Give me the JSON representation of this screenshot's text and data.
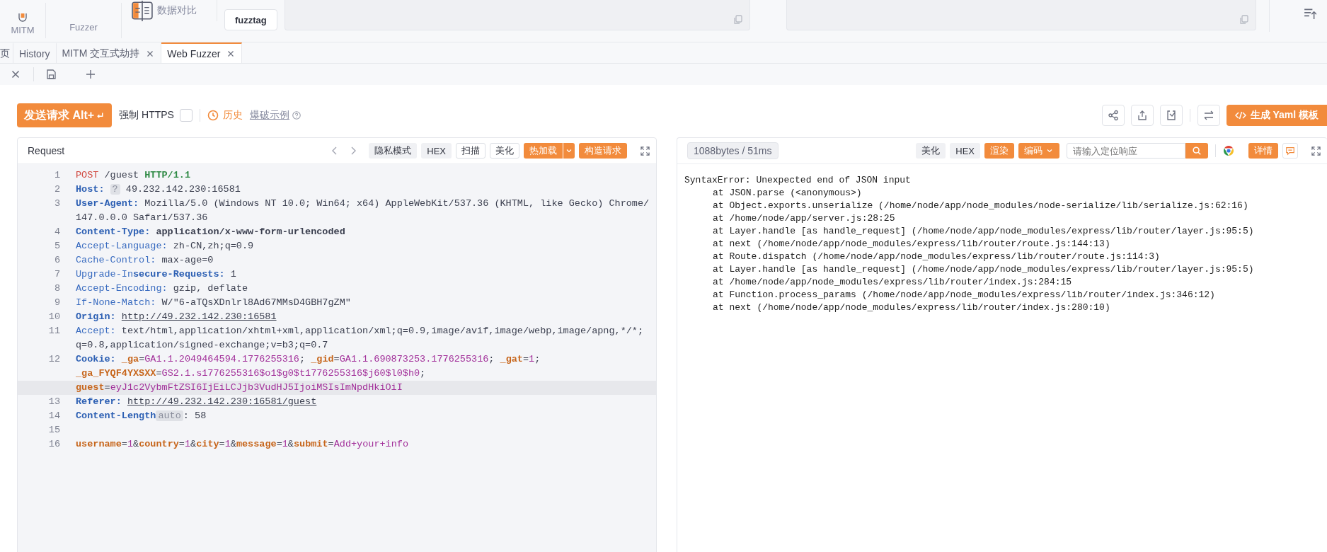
{
  "top_bar": {
    "nav": [
      {
        "label": "MITM",
        "kind": "mitm"
      },
      {
        "label": "Fuzzer",
        "kind": "plain"
      },
      {
        "label": "数据对比",
        "kind": "compare"
      }
    ],
    "buttons": [
      "fuzztag"
    ]
  },
  "tabs": [
    {
      "label": "页",
      "closable": false,
      "selected": false
    },
    {
      "label": "History",
      "closable": false,
      "selected": false
    },
    {
      "label": "MITM 交互式劫持",
      "closable": true,
      "selected": false
    },
    {
      "label": "Web Fuzzer",
      "closable": true,
      "selected": true
    }
  ],
  "toolbar": {
    "send_button": "发送请求 Alt+",
    "force_https": {
      "label": "强制 HTTPS",
      "checked": false
    },
    "history": "历史",
    "example_link": "爆破示例",
    "yaml_button": "生成 Yaml 模板"
  },
  "request": {
    "title": "Request",
    "buttons": [
      {
        "label": "隐私模式",
        "kind": "toggle",
        "selected": false
      },
      {
        "label": "HEX",
        "kind": "toggle",
        "selected": false
      },
      {
        "label": "扫描",
        "kind": "outline"
      },
      {
        "label": "美化",
        "kind": "outline"
      },
      {
        "label": "热加载",
        "kind": "split"
      },
      {
        "label": "构造请求",
        "kind": "primary"
      }
    ],
    "lines": [
      {
        "number": "1",
        "highlighted": false,
        "rows": [
          {
            "tokens": [
              {
                "kind": "method",
                "text": "POST"
              },
              {
                "kind": "value",
                "text": " /guest "
              },
              {
                "kind": "version",
                "text": "HTTP/1.1"
              }
            ]
          }
        ]
      },
      {
        "number": "2",
        "highlighted": false,
        "rows": [
          {
            "tokens": [
              {
                "kind": "key",
                "text": "Host: "
              },
              {
                "kind": "badge",
                "text": "?"
              },
              {
                "kind": "value",
                "text": " 49.232.142.230:16581"
              }
            ]
          }
        ]
      },
      {
        "number": "3",
        "highlighted": false,
        "rows": [
          {
            "tokens": [
              {
                "kind": "key",
                "text": "User-Agent:"
              },
              {
                "kind": "value",
                "text": " Mozilla/5.0 (Windows NT 10.0; Win64; x64) AppleWebKit/537.36 (KHTML, like Gecko) Chrome/"
              }
            ]
          },
          {
            "tokens": [
              {
                "kind": "value",
                "text": "147.0.0.0 Safari/537.36"
              }
            ]
          }
        ]
      },
      {
        "number": "4",
        "highlighted": false,
        "rows": [
          {
            "tokens": [
              {
                "kind": "key",
                "text": "Content-Type: "
              },
              {
                "kind": "strong",
                "text": "application/x-www-form-urlencoded"
              }
            ]
          }
        ]
      },
      {
        "number": "5",
        "highlighted": false,
        "rows": [
          {
            "tokens": [
              {
                "kind": "key-plain",
                "text": "Accept-Language:"
              },
              {
                "kind": "value",
                "text": " zh-CN,zh;q=0.9"
              }
            ]
          }
        ]
      },
      {
        "number": "6",
        "highlighted": false,
        "rows": [
          {
            "tokens": [
              {
                "kind": "key-plain",
                "text": "Cache-Control:"
              },
              {
                "kind": "value",
                "text": " max-age=0"
              }
            ]
          }
        ]
      },
      {
        "number": "7",
        "highlighted": false,
        "rows": [
          {
            "tokens": [
              {
                "kind": "key-plain",
                "text": "Upgrade-In"
              },
              {
                "kind": "key",
                "text": "secure-Requests:"
              },
              {
                "kind": "value",
                "text": " 1"
              }
            ]
          }
        ]
      },
      {
        "number": "8",
        "highlighted": false,
        "rows": [
          {
            "tokens": [
              {
                "kind": "key-plain",
                "text": "Accept-Encoding:"
              },
              {
                "kind": "value",
                "text": " gzip, deflate"
              }
            ]
          }
        ]
      },
      {
        "number": "9",
        "highlighted": false,
        "rows": [
          {
            "tokens": [
              {
                "kind": "key-plain",
                "text": "If-None-Match:"
              },
              {
                "kind": "value",
                "text": " W/\"6-aTQsXDnlrl8Ad67MMsD4GBH7gZM\""
              }
            ]
          }
        ]
      },
      {
        "number": "10",
        "highlighted": false,
        "rows": [
          {
            "tokens": [
              {
                "kind": "key",
                "text": "Origin: "
              },
              {
                "kind": "link",
                "text": "http://49.232.142.230:16581"
              }
            ]
          }
        ]
      },
      {
        "number": "11",
        "highlighted": false,
        "rows": [
          {
            "tokens": [
              {
                "kind": "key-plain",
                "text": "Accept:"
              },
              {
                "kind": "value",
                "text": " text/html,application/xhtml+xml,application/xml;q=0.9,image/avif,image/webp,image/apng,*/*;"
              }
            ]
          },
          {
            "tokens": [
              {
                "kind": "value",
                "text": "q=0.8,application/signed-exchange;v=b3;q=0.7"
              }
            ]
          }
        ]
      },
      {
        "number": "12",
        "highlighted": true,
        "rows": [
          {
            "tokens": [
              {
                "kind": "key",
                "text": "Cookie: "
              },
              {
                "kind": "name",
                "text": "_ga"
              },
              {
                "kind": "value",
                "text": "="
              },
              {
                "kind": "data",
                "text": "GA1.1.2049464594.1776255316"
              },
              {
                "kind": "value",
                "text": "; "
              },
              {
                "kind": "name",
                "text": "_gid"
              },
              {
                "kind": "value",
                "text": "="
              },
              {
                "kind": "data",
                "text": "GA1.1.690873253.1776255316"
              },
              {
                "kind": "value",
                "text": "; "
              },
              {
                "kind": "name",
                "text": "_gat"
              },
              {
                "kind": "value",
                "text": "="
              },
              {
                "kind": "data",
                "text": "1"
              },
              {
                "kind": "value",
                "text": ";"
              }
            ]
          },
          {
            "tokens": [
              {
                "kind": "name",
                "text": "_ga_FYQF4YXSXX"
              },
              {
                "kind": "value",
                "text": "="
              },
              {
                "kind": "data",
                "text": "GS2.1.s1776255316$o1$g0$t1776255316$j60$l0$h0"
              },
              {
                "kind": "value",
                "text": ";"
              }
            ]
          },
          {
            "tokens": [
              {
                "kind": "name",
                "text": "guest"
              },
              {
                "kind": "value",
                "text": "="
              },
              {
                "kind": "data",
                "text": "eyJ1c2VybmFtZSI6IjEiLCJjb3VudHJ5IjoiMSIsImNpdHkiOiI"
              }
            ]
          }
        ]
      },
      {
        "number": "13",
        "highlighted": false,
        "rows": [
          {
            "tokens": [
              {
                "kind": "key",
                "text": "Referer: "
              },
              {
                "kind": "link",
                "text": "http://49.232.142.230:16581/guest"
              }
            ]
          }
        ]
      },
      {
        "number": "14",
        "highlighted": false,
        "rows": [
          {
            "tokens": [
              {
                "kind": "key",
                "text": "Content-Length"
              },
              {
                "kind": "badge",
                "text": "auto"
              },
              {
                "kind": "value",
                "text": ": 58"
              }
            ]
          }
        ]
      },
      {
        "number": "15",
        "highlighted": false,
        "rows": [
          {
            "tokens": []
          }
        ]
      },
      {
        "number": "16",
        "highlighted": false,
        "rows": [
          {
            "tokens": [
              {
                "kind": "name",
                "text": "username"
              },
              {
                "kind": "value",
                "text": "="
              },
              {
                "kind": "data",
                "text": "1"
              },
              {
                "kind": "value",
                "text": "&"
              },
              {
                "kind": "name",
                "text": "country"
              },
              {
                "kind": "value",
                "text": "="
              },
              {
                "kind": "data",
                "text": "1"
              },
              {
                "kind": "value",
                "text": "&"
              },
              {
                "kind": "name",
                "text": "city"
              },
              {
                "kind": "value",
                "text": "="
              },
              {
                "kind": "data",
                "text": "1"
              },
              {
                "kind": "value",
                "text": "&"
              },
              {
                "kind": "name",
                "text": "message"
              },
              {
                "kind": "value",
                "text": "="
              },
              {
                "kind": "data",
                "text": "1"
              },
              {
                "kind": "value",
                "text": "&"
              },
              {
                "kind": "name",
                "text": "submit"
              },
              {
                "kind": "value",
                "text": "="
              },
              {
                "kind": "data",
                "text": "Add+your+info"
              }
            ]
          }
        ]
      }
    ]
  },
  "response": {
    "stats": "1088bytes / 51ms",
    "buttons": [
      {
        "label": "美化",
        "kind": "toggle",
        "selected": false
      },
      {
        "label": "HEX",
        "kind": "toggle",
        "selected": false
      },
      {
        "label": "渲染",
        "kind": "toggle",
        "selected": true
      },
      {
        "label": "编码",
        "kind": "dropdown"
      }
    ],
    "search": {
      "placeholder": "请输入定位响应"
    },
    "detail_button": "详情",
    "lines": [
      {
        "kind": "error",
        "text": "SyntaxError: Unexpected end of JSON input"
      },
      {
        "kind": "frame",
        "text": "at JSON.parse (<anonymous>)"
      },
      {
        "kind": "frame",
        "text": "at Object.exports.unserialize (/home/node/app/node_modules/node-serialize/lib/serialize.js:62:16)"
      },
      {
        "kind": "frame",
        "text": "at /home/node/app/server.js:28:25"
      },
      {
        "kind": "frame",
        "text": "at Layer.handle [as handle_request] (/home/node/app/node_modules/express/lib/router/layer.js:95:5)"
      },
      {
        "kind": "frame",
        "text": "at next (/home/node/app/node_modules/express/lib/router/route.js:144:13)"
      },
      {
        "kind": "frame",
        "text": "at Route.dispatch (/home/node/app/node_modules/express/lib/router/route.js:114:3)"
      },
      {
        "kind": "frame",
        "text": "at Layer.handle [as handle_request] (/home/node/app/node_modules/express/lib/router/layer.js:95:5)"
      },
      {
        "kind": "frame",
        "text": "at /home/node/app/node_modules/express/lib/router/index.js:284:15"
      },
      {
        "kind": "frame",
        "text": "at Function.process_params (/home/node/app/node_modules/express/lib/router/index.js:346:12)"
      },
      {
        "kind": "frame",
        "text": "at next (/home/node/app/node_modules/express/lib/router/index.js:280:10)"
      }
    ]
  }
}
